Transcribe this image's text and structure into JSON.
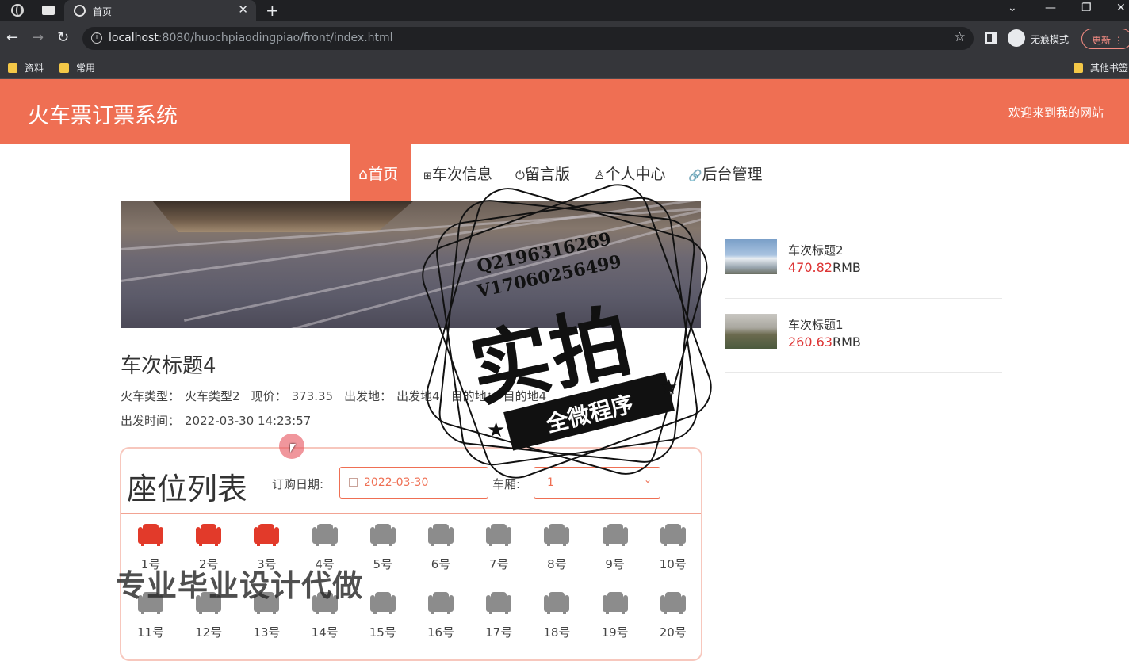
{
  "browser": {
    "tab_title": "首页",
    "close_glyph": "✕",
    "new_tab_glyph": "+",
    "url_host": "localhost",
    "url_rest": ":8080/huochpiaodingpiao/front/index.html",
    "incognito_label": "无痕模式",
    "update_label": "更新",
    "bookmarks": [
      "资料",
      "常用"
    ],
    "other_bookmarks": "其他书签"
  },
  "header": {
    "site_title": "火车票订票系统",
    "welcome": "欢迎来到我的网站"
  },
  "nav": {
    "items": [
      {
        "icon": "home-icon",
        "glyph": "⌂",
        "label": "首页",
        "active": true
      },
      {
        "icon": "train-icon",
        "glyph": "⊞",
        "label": "车次信息",
        "active": false
      },
      {
        "icon": "power-icon",
        "glyph": "⏻",
        "label": "留言版",
        "active": false
      },
      {
        "icon": "user-icon",
        "glyph": "♙",
        "label": "个人中心",
        "active": false
      },
      {
        "icon": "link-icon",
        "glyph": "🔗",
        "label": "后台管理",
        "active": false
      }
    ]
  },
  "detail": {
    "title": "车次标题4",
    "type_label": "火车类型：",
    "type_value": "火车类型2",
    "price_label": "现价：",
    "price_value": "373.35",
    "from_label": "出发地：",
    "from_value": "出发地4",
    "to_label": "目的地：",
    "to_value": "目的地4",
    "time_label": "出发时间：",
    "time_value": "2022-03-30 14:23:57"
  },
  "seats": {
    "title": "座位列表",
    "date_label": "订购日期:",
    "date_value": "2022-03-30",
    "car_label": "车厢:",
    "car_value": "1",
    "colors": {
      "booked": "#e23a2a",
      "free": "#8c8c8c"
    },
    "items": [
      {
        "label": "1号",
        "booked": true
      },
      {
        "label": "2号",
        "booked": true
      },
      {
        "label": "3号",
        "booked": true
      },
      {
        "label": "4号",
        "booked": false
      },
      {
        "label": "5号",
        "booked": false
      },
      {
        "label": "6号",
        "booked": false
      },
      {
        "label": "7号",
        "booked": false
      },
      {
        "label": "8号",
        "booked": false
      },
      {
        "label": "9号",
        "booked": false
      },
      {
        "label": "10号",
        "booked": false
      },
      {
        "label": "11号",
        "booked": false
      },
      {
        "label": "12号",
        "booked": false
      },
      {
        "label": "13号",
        "booked": false
      },
      {
        "label": "14号",
        "booked": false
      },
      {
        "label": "15号",
        "booked": false
      },
      {
        "label": "16号",
        "booked": false
      },
      {
        "label": "17号",
        "booked": false
      },
      {
        "label": "18号",
        "booked": false
      },
      {
        "label": "19号",
        "booked": false
      },
      {
        "label": "20号",
        "booked": false
      }
    ]
  },
  "sidebar": {
    "items": [
      {
        "name": "车次标题2",
        "price": "470.82",
        "unit": "RMB"
      },
      {
        "name": "车次标题1",
        "price": "260.63",
        "unit": "RMB"
      }
    ]
  },
  "watermark": {
    "qq": "Q2196316269",
    "wx": "V17060256499",
    "big": "实拍",
    "ribbon": "全微程序",
    "bottom_text": "专业毕业设计代做"
  },
  "theme": {
    "accent": "#ef6f53",
    "price_red": "#d33"
  }
}
